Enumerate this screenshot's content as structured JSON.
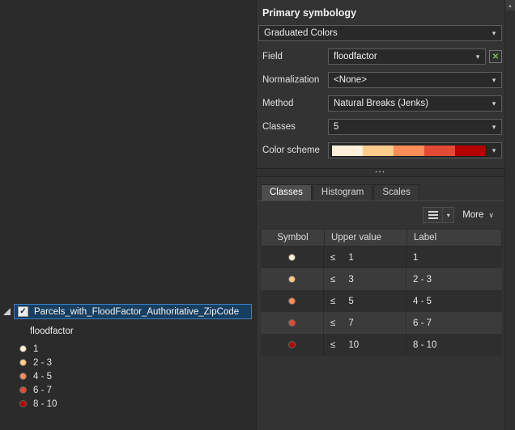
{
  "icons": {
    "combo_arrow": "▾",
    "more_chevron": "∨",
    "grip_dots": "•••",
    "check": "✓",
    "expression_x": "✕",
    "scroll_up": "▴"
  },
  "classes": {
    "colors": [
      "#fef0d9",
      "#fdcc8a",
      "#fc8d59",
      "#e34a33",
      "#b30000"
    ]
  },
  "symbology": {
    "title": "Primary symbology",
    "type_value": "Graduated Colors",
    "rows": [
      {
        "label": "Field",
        "value": "floodfactor"
      },
      {
        "label": "Normalization",
        "value": "<None>"
      },
      {
        "label": "Method",
        "value": "Natural Breaks (Jenks)"
      },
      {
        "label": "Classes",
        "value": "5"
      }
    ],
    "color_scheme_label": "Color scheme"
  },
  "tabs": [
    {
      "label": "Classes",
      "active": true
    },
    {
      "label": "Histogram",
      "active": false
    },
    {
      "label": "Scales",
      "active": false
    }
  ],
  "toolbar": {
    "more_label": "More"
  },
  "table": {
    "headers": [
      "Symbol",
      "Upper value",
      "Label"
    ],
    "le": "≤",
    "rows": [
      {
        "upper": "1",
        "label": "1"
      },
      {
        "upper": "3",
        "label": "2 - 3"
      },
      {
        "upper": "5",
        "label": "4 - 5"
      },
      {
        "upper": "7",
        "label": "6 - 7"
      },
      {
        "upper": "10",
        "label": "8 - 10"
      }
    ]
  },
  "toc": {
    "layer_name": "Parcels_with_FloodFactor_Authoritative_ZipCode",
    "field_name": "floodfactor",
    "legend": [
      "1",
      "2 - 3",
      "4 - 5",
      "6 - 7",
      "8 - 10"
    ]
  }
}
